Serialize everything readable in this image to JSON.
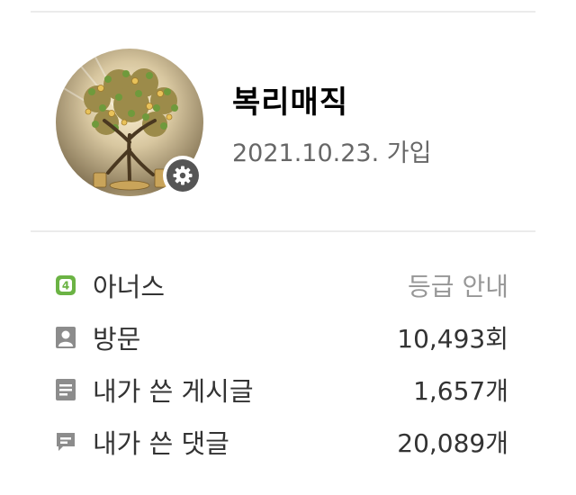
{
  "profile": {
    "nickname": "복리매직",
    "joined": "2021.10.23. 가입",
    "avatar_icon": "money-tree-avatar",
    "settings_icon": "gear-icon"
  },
  "info": {
    "level": {
      "icon": "level-badge-icon",
      "icon_text": "4",
      "icon_color": "#6bb344",
      "label": "아너스",
      "link": "등급 안내"
    },
    "visits": {
      "icon": "visit-person-icon",
      "label": "방문",
      "value": "10,493회"
    },
    "posts": {
      "icon": "post-document-icon",
      "label": "내가 쓴 게시글",
      "value": "1,657개"
    },
    "comments": {
      "icon": "comment-bubble-icon",
      "label": "내가 쓴 댓글",
      "value": "20,089개"
    }
  },
  "colors": {
    "level_green": "#6bb344",
    "icon_gray": "#8c8c8c",
    "link_gray": "#979797",
    "divider": "#ebebeb"
  }
}
